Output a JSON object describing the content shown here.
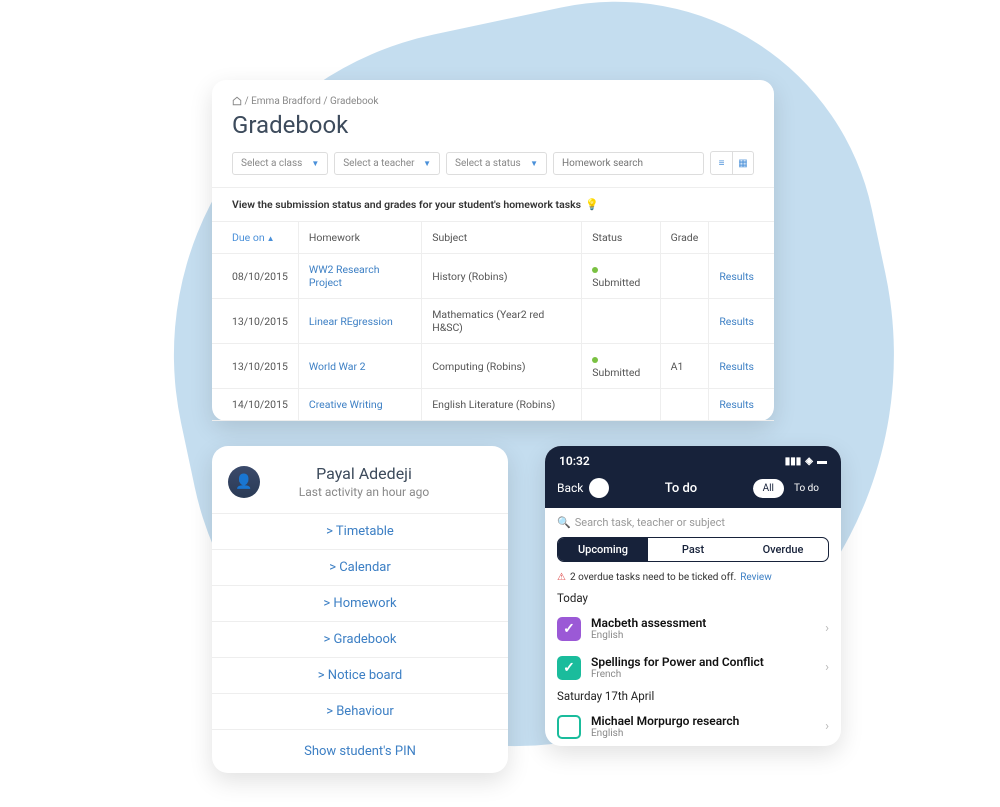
{
  "gradebook": {
    "breadcrumb": {
      "student": "Emma Bradford",
      "page": "Gradebook"
    },
    "title": "Gradebook",
    "filters": {
      "class": "Select a class",
      "teacher": "Select a teacher",
      "status": "Select a status",
      "search_placeholder": "Homework search"
    },
    "instruction": "View the submission status and grades for your student's homework tasks",
    "columns": {
      "due": "Due on",
      "homework": "Homework",
      "subject": "Subject",
      "status": "Status",
      "grade": "Grade"
    },
    "rows": [
      {
        "due": "08/10/2015",
        "homework": "WW2 Research Project",
        "subject": "History (Robins)",
        "status": "Submitted",
        "grade": "",
        "action": "Results"
      },
      {
        "due": "13/10/2015",
        "homework": "Linear REgression",
        "subject": "Mathematics (Year2 red H&SC)",
        "status": "",
        "grade": "",
        "action": "Results"
      },
      {
        "due": "13/10/2015",
        "homework": "World War 2",
        "subject": "Computing (Robins)",
        "status": "Submitted",
        "grade": "A1",
        "action": "Results"
      },
      {
        "due": "14/10/2015",
        "homework": "Creative Writing",
        "subject": "English Literature (Robins)",
        "status": "",
        "grade": "",
        "action": "Results"
      }
    ]
  },
  "student": {
    "name": "Payal Adedeji",
    "last_activity": "Last activity an hour ago",
    "links": [
      "> Timetable",
      "> Calendar",
      "> Homework",
      "> Gradebook",
      "> Notice board",
      "> Behaviour"
    ],
    "pin_label": "Show student's PIN"
  },
  "mobile": {
    "time": "10:32",
    "back": "Back",
    "title": "To do",
    "toggle": {
      "all": "All",
      "todo": "To do"
    },
    "search_placeholder": "Search task, teacher or subject",
    "tabs": {
      "upcoming": "Upcoming",
      "past": "Past",
      "overdue": "Overdue"
    },
    "alert_text": "2 overdue tasks need to be ticked off.",
    "alert_link": "Review",
    "section_today": "Today",
    "section_sat": "Saturday 17th April",
    "tasks": {
      "t1": {
        "title": "Macbeth assessment",
        "subject": "English"
      },
      "t2": {
        "title": "Spellings for Power and Conflict",
        "subject": "French"
      },
      "t3": {
        "title": "Michael Morpurgo research",
        "subject": "English"
      }
    }
  }
}
